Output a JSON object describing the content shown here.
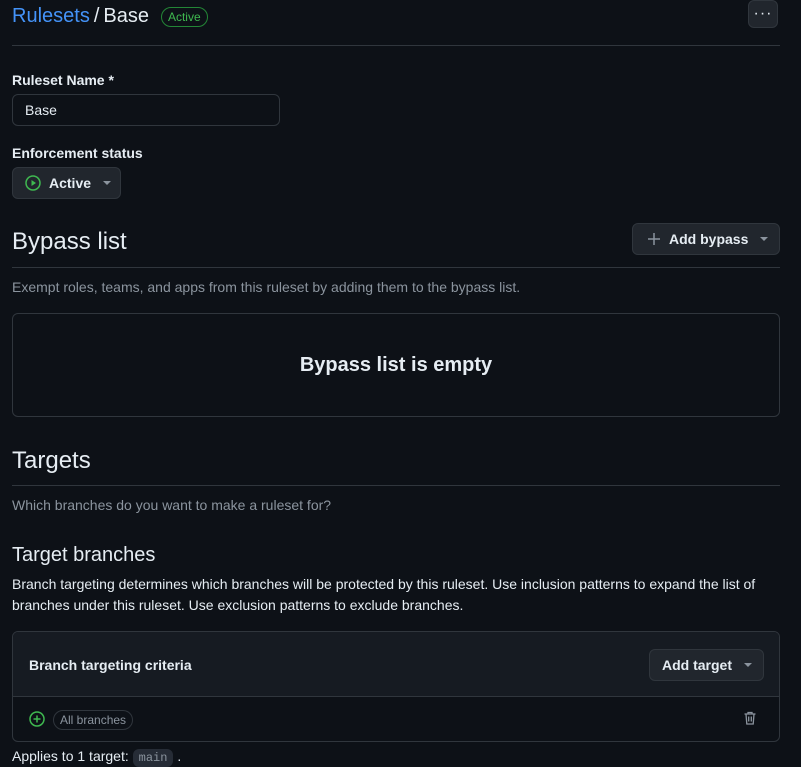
{
  "header": {
    "breadcrumb_link": "Rulesets",
    "breadcrumb_separator": "/",
    "breadcrumb_current": "Base",
    "status_badge": "Active",
    "more_button_label": "···"
  },
  "ruleset_name": {
    "label": "Ruleset Name *",
    "value": "Base"
  },
  "enforcement": {
    "label": "Enforcement status",
    "selected": "Active"
  },
  "bypass": {
    "title": "Bypass list",
    "add_button": "Add bypass",
    "description": "Exempt roles, teams, and apps from this ruleset by adding them to the bypass list.",
    "empty_message": "Bypass list is empty"
  },
  "targets": {
    "title": "Targets",
    "description": "Which branches do you want to make a ruleset for?",
    "branches_title": "Target branches",
    "branches_description": "Branch targeting determines which branches will be protected by this ruleset. Use inclusion patterns to expand the list of branches under this ruleset. Use exclusion patterns to exclude branches.",
    "criteria_title": "Branch targeting criteria",
    "add_target_button": "Add target",
    "criteria_items": [
      {
        "label": "All branches"
      }
    ],
    "applies_prefix": "Applies to 1 target:",
    "applies_code": "main",
    "applies_suffix": "."
  },
  "colors": {
    "background": "#0d1117",
    "accent_link": "#4493f8",
    "success": "#3fb950",
    "border": "#30363d"
  }
}
